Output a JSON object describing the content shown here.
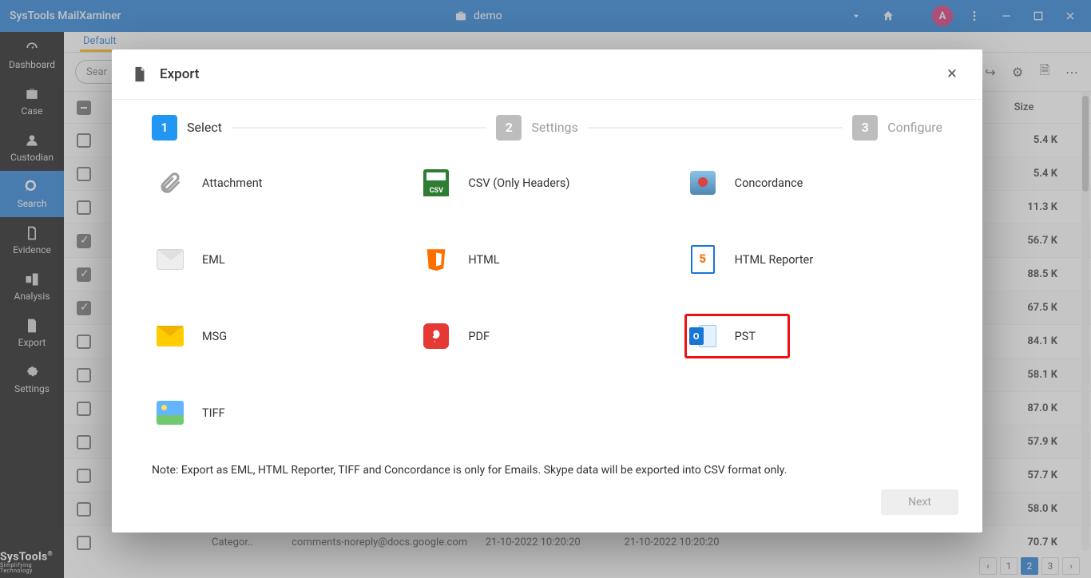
{
  "app": {
    "title": "SysTools MailXaminer",
    "brand": "SysTools",
    "brand_sub": "Simplifying Technology"
  },
  "case": {
    "name": "demo"
  },
  "avatar": "A",
  "sidebar": {
    "items": [
      {
        "label": "Dashboard"
      },
      {
        "label": "Case"
      },
      {
        "label": "Custodian"
      },
      {
        "label": "Search"
      },
      {
        "label": "Evidence"
      },
      {
        "label": "Analysis"
      },
      {
        "label": "Export"
      },
      {
        "label": "Settings"
      }
    ]
  },
  "tabs": {
    "default": "Default"
  },
  "search_placeholder": "Sear",
  "columns": {
    "size": "Size"
  },
  "rows": [
    {
      "checked": "",
      "size": "5.4 K"
    },
    {
      "checked": "",
      "size": "5.4 K"
    },
    {
      "checked": "",
      "size": "11.3 K"
    },
    {
      "checked": "checked",
      "size": "56.7 K"
    },
    {
      "checked": "checked",
      "size": "88.5 K"
    },
    {
      "checked": "checked",
      "size": "67.5 K"
    },
    {
      "checked": "",
      "size": "84.1 K"
    },
    {
      "checked": "",
      "size": "58.1 K"
    },
    {
      "checked": "",
      "size": "87.0 K"
    },
    {
      "checked": "",
      "size": "57.9 K"
    },
    {
      "checked": "",
      "size": "57.7 K"
    },
    {
      "checked": "",
      "size": "58.0 K"
    },
    {
      "checked": "",
      "size": "70.7 K"
    }
  ],
  "bottom_row": {
    "name_label": "Categor..",
    "email": "comments-noreply@docs.google.com",
    "date1": "21-10-2022 10:20:20",
    "date2": "21-10-2022 10:20:20"
  },
  "pager": {
    "p1": "1",
    "p2": "2",
    "p3": "3"
  },
  "modal": {
    "title": "Export",
    "steps": {
      "s1": "1",
      "l1": "Select",
      "s2": "2",
      "l2": "Settings",
      "s3": "3",
      "l3": "Configure"
    },
    "options": {
      "attachment": "Attachment",
      "csv": "CSV (Only Headers)",
      "concord": "Concordance",
      "eml": "EML",
      "html": "HTML",
      "htmlrep": "HTML Reporter",
      "msg": "MSG",
      "pdf": "PDF",
      "pst": "PST",
      "tiff": "TIFF"
    },
    "note": "Note: Export as EML, HTML Reporter, TIFF and Concordance is only for Emails. Skype data will be exported into CSV format only.",
    "next": "Next"
  }
}
